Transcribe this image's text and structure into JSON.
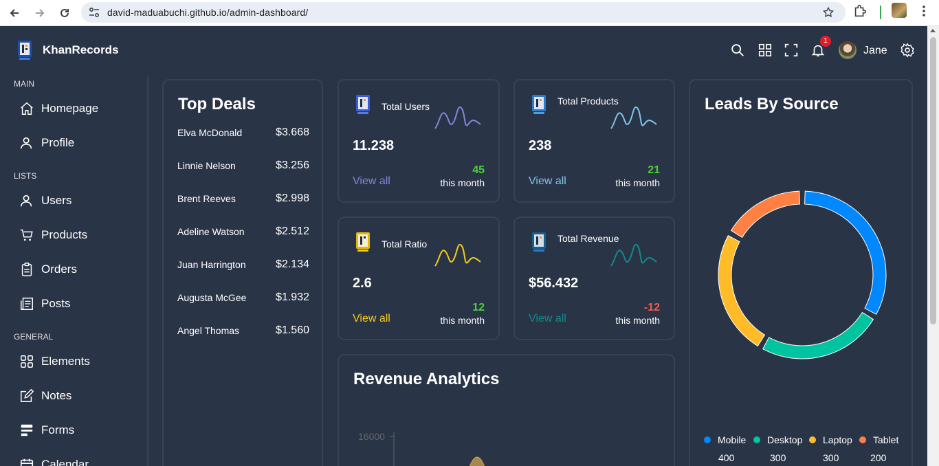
{
  "browser": {
    "url": "david-maduabuchi.github.io/admin-dashboard/"
  },
  "app": {
    "name": "KhanRecords",
    "user_name": "Jane",
    "notification_count": "1"
  },
  "sidebar": {
    "sections": [
      {
        "title": "MAIN",
        "items": [
          {
            "label": "Homepage",
            "icon": "home-icon"
          },
          {
            "label": "Profile",
            "icon": "user-icon"
          }
        ]
      },
      {
        "title": "LISTS",
        "items": [
          {
            "label": "Users",
            "icon": "users-icon"
          },
          {
            "label": "Products",
            "icon": "cart-icon"
          },
          {
            "label": "Orders",
            "icon": "clipboard-icon"
          },
          {
            "label": "Posts",
            "icon": "posts-icon"
          }
        ]
      },
      {
        "title": "GENERAL",
        "items": [
          {
            "label": "Elements",
            "icon": "grid-icon"
          },
          {
            "label": "Notes",
            "icon": "note-icon"
          },
          {
            "label": "Forms",
            "icon": "forms-icon"
          },
          {
            "label": "Calendar",
            "icon": "calendar-icon"
          }
        ]
      }
    ]
  },
  "top_deals": {
    "title": "Top Deals",
    "rows": [
      {
        "name": "Elva McDonald",
        "amount": "$3.668"
      },
      {
        "name": "Linnie Nelson",
        "amount": "$3.256"
      },
      {
        "name": "Brent Reeves",
        "amount": "$2.998"
      },
      {
        "name": "Adeline Watson",
        "amount": "$2.512"
      },
      {
        "name": "Juan Harrington",
        "amount": "$2.134"
      },
      {
        "name": "Augusta McGee",
        "amount": "$1.932"
      },
      {
        "name": "Angel Thomas",
        "amount": "$1.560"
      }
    ]
  },
  "stat_boxes": [
    {
      "title": "Total Users",
      "value": "11.238",
      "link": "View all",
      "percent": "45",
      "period": "this month",
      "color": "#8884d8",
      "percent_color": "#4cd137"
    },
    {
      "title": "Total Products",
      "value": "238",
      "link": "View all",
      "percent": "21",
      "period": "this month",
      "color": "#82c4ea",
      "percent_color": "#4cd137"
    },
    {
      "title": "Total Ratio",
      "value": "2.6",
      "link": "View all",
      "percent": "12",
      "period": "this month",
      "color": "#f5cd19",
      "percent_color": "#4cd137"
    },
    {
      "title": "Total Revenue",
      "value": "$56.432",
      "link": "View all",
      "percent": "-12",
      "period": "this month",
      "color": "#138a8a",
      "percent_color": "#f45b4b"
    }
  ],
  "revenue": {
    "title": "Revenue Analytics",
    "y_tick": "16000",
    "area_color": "#a6874f"
  },
  "leads": {
    "title": "Leads By Source",
    "chart_data": {
      "type": "pie",
      "title": "Leads By Source",
      "categories": [
        "Mobile",
        "Desktop",
        "Laptop",
        "Tablet"
      ],
      "values": [
        400,
        300,
        300,
        200
      ],
      "colors": [
        "#0088fe",
        "#00c49f",
        "#ffbb28",
        "#ff8042"
      ]
    },
    "legend": [
      {
        "label": "Mobile",
        "value": "400",
        "color": "#0088fe"
      },
      {
        "label": "Desktop",
        "value": "300",
        "color": "#00c49f"
      },
      {
        "label": "Laptop",
        "value": "300",
        "color": "#ffbb28"
      },
      {
        "label": "Tablet",
        "value": "200",
        "color": "#ff8042"
      }
    ]
  }
}
